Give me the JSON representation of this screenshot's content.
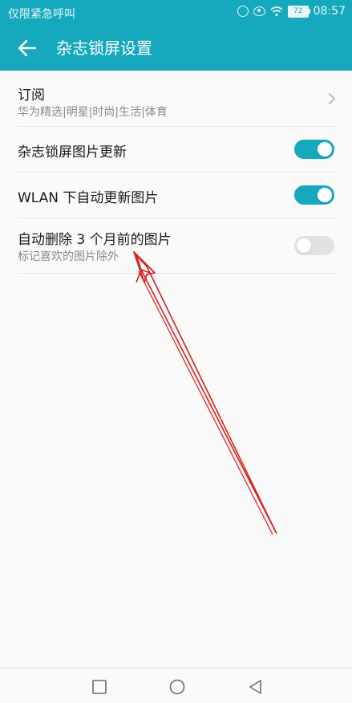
{
  "status_bar": {
    "left_text": "仅限紧急呼叫",
    "battery": "72",
    "time": "08:57"
  },
  "header": {
    "title": "杂志锁屏设置"
  },
  "settings": [
    {
      "label": "订阅",
      "sublabel": "华为精选|明星|时尚|生活|体育",
      "control": "chevron"
    },
    {
      "label": "杂志锁屏图片更新",
      "control": "toggle",
      "on": true
    },
    {
      "label": "WLAN 下自动更新图片",
      "control": "toggle",
      "on": true
    },
    {
      "label": "自动删除 3 个月前的图片",
      "sublabel": "标记喜欢的图片除外",
      "control": "toggle",
      "on": false
    }
  ],
  "colors": {
    "accent": "#16a9bd",
    "toggle_off": "#e2e2e2",
    "annotation_arrow": "#d81e1e"
  },
  "icons": {
    "back": "arrow-left-icon",
    "chevron": "chevron-right-icon",
    "nav": [
      "square-icon",
      "circle-icon",
      "triangle-back-icon"
    ]
  }
}
